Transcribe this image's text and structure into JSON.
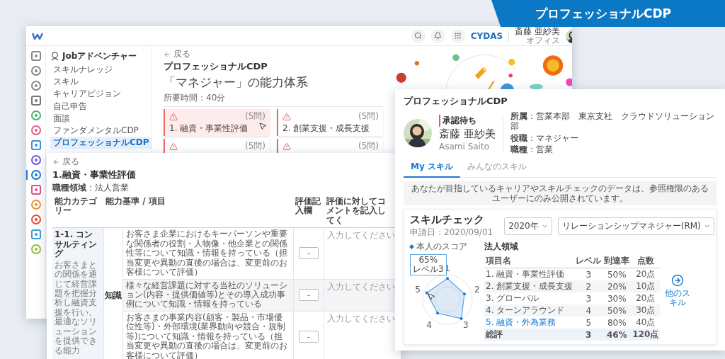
{
  "banner": {
    "title": "プロフェッショナルCDP"
  },
  "main_window": {
    "header": {
      "brand": "CYDAS",
      "user": {
        "name": "斎藤 亜紗美",
        "location": "オフィス"
      }
    },
    "rail": [
      {
        "selected": false
      },
      {
        "selected": false
      },
      {
        "selected": false
      },
      {
        "selected": false
      },
      {
        "selected": false
      },
      {
        "selected": false
      },
      {
        "selected": false
      },
      {
        "selected": false
      },
      {
        "selected": true
      },
      {
        "selected": false
      },
      {
        "selected": false
      },
      {
        "selected": false
      },
      {
        "selected": false
      },
      {
        "selected": false
      }
    ],
    "sidebar": {
      "title": "Jobアドベンチャー",
      "items": [
        {
          "label": "スキルナレッジ",
          "selected": false
        },
        {
          "label": "スキル",
          "selected": false
        },
        {
          "label": "キャリアビジョン",
          "selected": false
        },
        {
          "label": "自己申告",
          "selected": false
        },
        {
          "label": "面談",
          "selected": false
        },
        {
          "label": "ファンダメンタルCDP",
          "selected": false
        },
        {
          "label": "プロフェッショナルCDP",
          "selected": true
        }
      ]
    },
    "content": {
      "back": "戻る",
      "title": "プロフェッショナルCDP",
      "heading": "「マネジャー」の能力体系",
      "duration": "所要時間：40分",
      "cards": [
        {
          "label": "1. 融資・事業性評価",
          "count": "(5問)",
          "selected": true
        },
        {
          "label": "2. 創業支援・成長支援",
          "count": "(5問)",
          "selected": false
        },
        {
          "count": "(5問)",
          "selected": false
        },
        {
          "count": "(5問)",
          "selected": false
        }
      ]
    }
  },
  "evaluation_window": {
    "back": "戻る",
    "title": "1.融資・事業性評価",
    "job_area": "**職種領域**：法人営業",
    "columns": [
      "能力カテゴリー",
      "能力基準 / 項目",
      "評価記入欄",
      "評価に対してコメントを記入してく"
    ],
    "category": {
      "title": "1-1. コンサルティング",
      "description": "お客さまとの関係を通じて経営課題を把握分析し融資支援を行い、最適なソリューションを提供できる能力"
    },
    "group": "知識",
    "items": [
      {
        "text": "お客さま企業におけるキーパーソンや重要な関係者の役割・人物像・他企業との関係性等について知識・情報を持っている（担当変更や異動の直後の場合は、変更前のお客様について評価）",
        "score": "-",
        "comment_placeholder": "入力してください"
      },
      {
        "text": "様々な経営課題に対する当社のソリューション(内容・提供価値等)とその導入成功事例について知識・情報を持っている",
        "score": "-",
        "comment_placeholder": "入力してください"
      },
      {
        "text": "お客さまの事業内容(顧客・製品・市場優位性等)・外部環境(業界動向や競合・規制等)について知識・情報を持っている（担当変更や異動の直後の場合は、変更前のお客様について評価）",
        "score": "-",
        "comment_placeholder": "入力してください"
      }
    ]
  },
  "skill_window": {
    "title": "プロフェッショナルCDP",
    "profile": {
      "status": "承認待ち",
      "name": "斎藤 亜紗美",
      "name_romaji": "Asami Saito",
      "details": [
        "**所属**：営業本部　東京支社　クラウドソリューション部",
        "**役職**：マネジャー",
        "**職種**：営業"
      ]
    },
    "tabs": [
      {
        "label": "My スキル",
        "selected": true
      },
      {
        "label": "みんなのスキル",
        "selected": false
      }
    ],
    "notice": "あなたが目指しているキャリアやスキルチェックのデータは、参照権限のあるユーザーにのみ公開されています。",
    "skill_check": {
      "title": "スキルチェック",
      "date": "申請日：2020/09/01",
      "year_select": "2020年",
      "role_select": "リレーションシップマネジャー(RM)",
      "legend": "本人のスコア",
      "axes": [
        "1",
        "2",
        "3",
        "4",
        "5"
      ],
      "tooltip": [
        "65%",
        "レベル3"
      ],
      "table": {
        "title": "法人領域",
        "columns": [
          "項目名",
          "レベル",
          "到達率",
          "点数"
        ],
        "rows": [
          {
            "cells": [
              "1. 融資・事業性評価",
              "3",
              "50%",
              "20点"
            ],
            "highlighted": false
          },
          {
            "cells": [
              "2. 創業支援・成長支援",
              "2",
              "20%",
              "10点"
            ],
            "highlighted": false
          },
          {
            "cells": [
              "3. グローバル",
              "3",
              "30%",
              "20点"
            ],
            "highlighted": false
          },
          {
            "cells": [
              "4. ターンアラウンド",
              "4",
              "50%",
              "30点"
            ],
            "highlighted": false
          },
          {
            "cells": [
              "5. 融資・外為業務",
              "5",
              "80%",
              "40点"
            ],
            "highlighted": true
          }
        ],
        "total": [
          "総評",
          "3",
          "46%",
          "120点"
        ]
      },
      "more_button": "他のスキル"
    }
  }
}
